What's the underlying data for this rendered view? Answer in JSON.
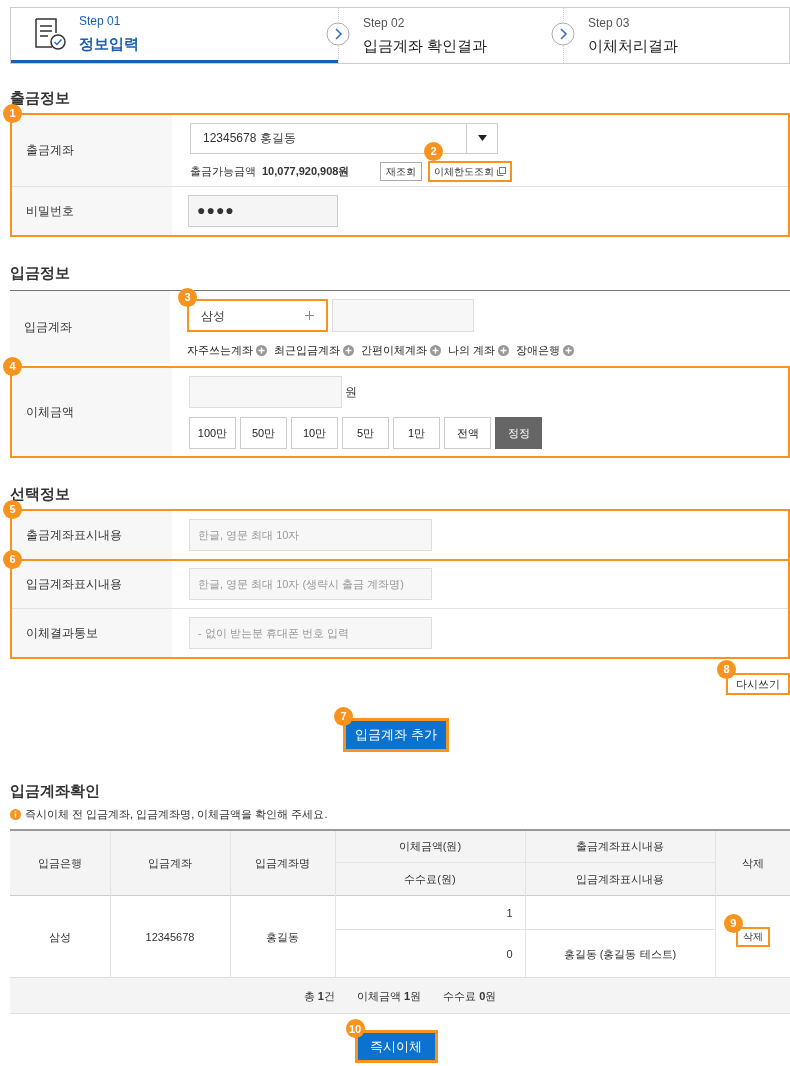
{
  "steps": [
    {
      "step": "Step 01",
      "title": "정보입력",
      "selected": true
    },
    {
      "step": "Step 02",
      "title": "입금계좌 확인결과",
      "selected": false
    },
    {
      "step": "Step 03",
      "title": "이체처리결과",
      "selected": false
    }
  ],
  "withdrawal": {
    "heading": "출금정보",
    "callout": "1",
    "account": {
      "label": "출금계좌",
      "value": "12345678 홍길동",
      "available_label": "출금가능금액",
      "available_amount": "10,077,920,908원",
      "refresh_button": "재조회",
      "limit_button": {
        "label": "이체한도조회",
        "callout": "2"
      }
    },
    "password": {
      "label": "비밀번호",
      "value": "●●●●"
    }
  },
  "deposit": {
    "heading": "입금정보",
    "account": {
      "label": "입금계좌",
      "bank": "삼성",
      "bank_callout": "3",
      "shortcuts": [
        "자주쓰는계좌",
        "최근입금계좌",
        "간편이체계좌",
        "나의 계좌",
        "장애은행"
      ]
    },
    "amount": {
      "label": "이체금액",
      "callout": "4",
      "unit": "원",
      "buttons": [
        {
          "label": "100만",
          "kind": "amount"
        },
        {
          "label": "50만",
          "kind": "amount"
        },
        {
          "label": "10만",
          "kind": "amount"
        },
        {
          "label": "5만",
          "kind": "amount"
        },
        {
          "label": "1만",
          "kind": "amount"
        },
        {
          "label": "전액",
          "kind": "amount"
        },
        {
          "label": "정정",
          "kind": "correct"
        }
      ]
    }
  },
  "optional": {
    "heading": "선택정보",
    "groups": [
      {
        "callout": "5",
        "rows": [
          {
            "label": "출금계좌표시내용",
            "placeholder": "한글, 영문 최대 10자"
          }
        ]
      },
      {
        "callout": "6",
        "rows": [
          {
            "label": "입금계좌표시내용",
            "placeholder": "한글, 영문 최대 10자 (생략시 출금 계좌명)"
          },
          {
            "label": "이체결과통보",
            "placeholder": "- 없이 받는분 휴대폰 번호 입력"
          }
        ]
      }
    ],
    "reset_button": {
      "label": "다시쓰기",
      "callout": "8"
    }
  },
  "add_button": {
    "label": "입금계좌 추가",
    "callout": "7"
  },
  "confirm": {
    "heading": "입금계좌확인",
    "notice": "즉시이체 전 입금계좌, 입금계좌명, 이체금액을 확인해 주세요.",
    "header": {
      "bank": "입금은행",
      "account": "입금계좌",
      "name": "입금계좌명",
      "amount": "이체금액(원)",
      "fee": "수수료(원)",
      "out_memo": "출금계좌표시내용",
      "in_memo": "입금계좌표시내용",
      "delete": "삭제"
    },
    "rows": [
      {
        "bank": "삼성",
        "account": "12345678",
        "name": "홍길동",
        "amount": "1",
        "fee": "0",
        "in_memo": "홍길동 (홍길동 테스트)",
        "delete_button": {
          "label": "삭제",
          "callout": "9"
        }
      }
    ],
    "summary": [
      "총 **1**건",
      "이체금액 **1**원",
      "수수료 **0**원"
    ]
  },
  "submit_button": {
    "label": "즉시이체",
    "callout": "10"
  }
}
